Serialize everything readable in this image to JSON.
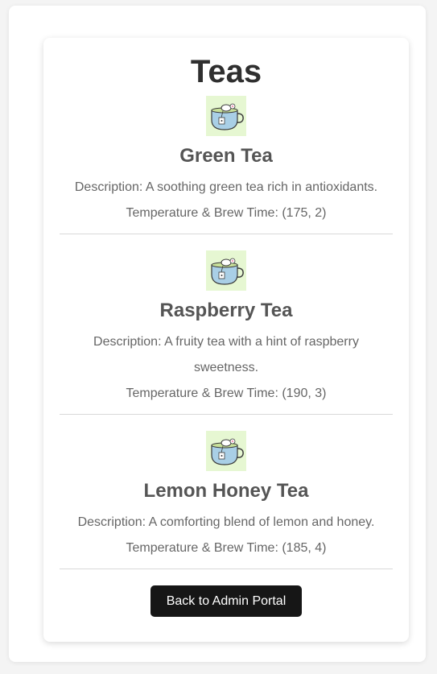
{
  "page": {
    "title": "Teas",
    "back_button_label": "Back to Admin Portal"
  },
  "teas": [
    {
      "name": "Green Tea",
      "description": "Description: A soothing green tea rich in antioxidants.",
      "temp_brew": "Temperature & Brew Time: (175, 2)",
      "icon": "tea-cup-icon"
    },
    {
      "name": "Raspberry Tea",
      "description": "Description: A fruity tea with a hint of raspberry sweetness.",
      "temp_brew": "Temperature & Brew Time: (190, 3)",
      "icon": "tea-cup-icon"
    },
    {
      "name": "Lemon Honey Tea",
      "description": "Description: A comforting blend of lemon and honey.",
      "temp_brew": "Temperature & Brew Time: (185, 4)",
      "icon": "tea-cup-icon"
    }
  ],
  "colors": {
    "button_bg": "#161616",
    "title_text": "#2f2f2f",
    "icon_bg": "#e6f7d2",
    "cup": "#a9cfe6"
  }
}
